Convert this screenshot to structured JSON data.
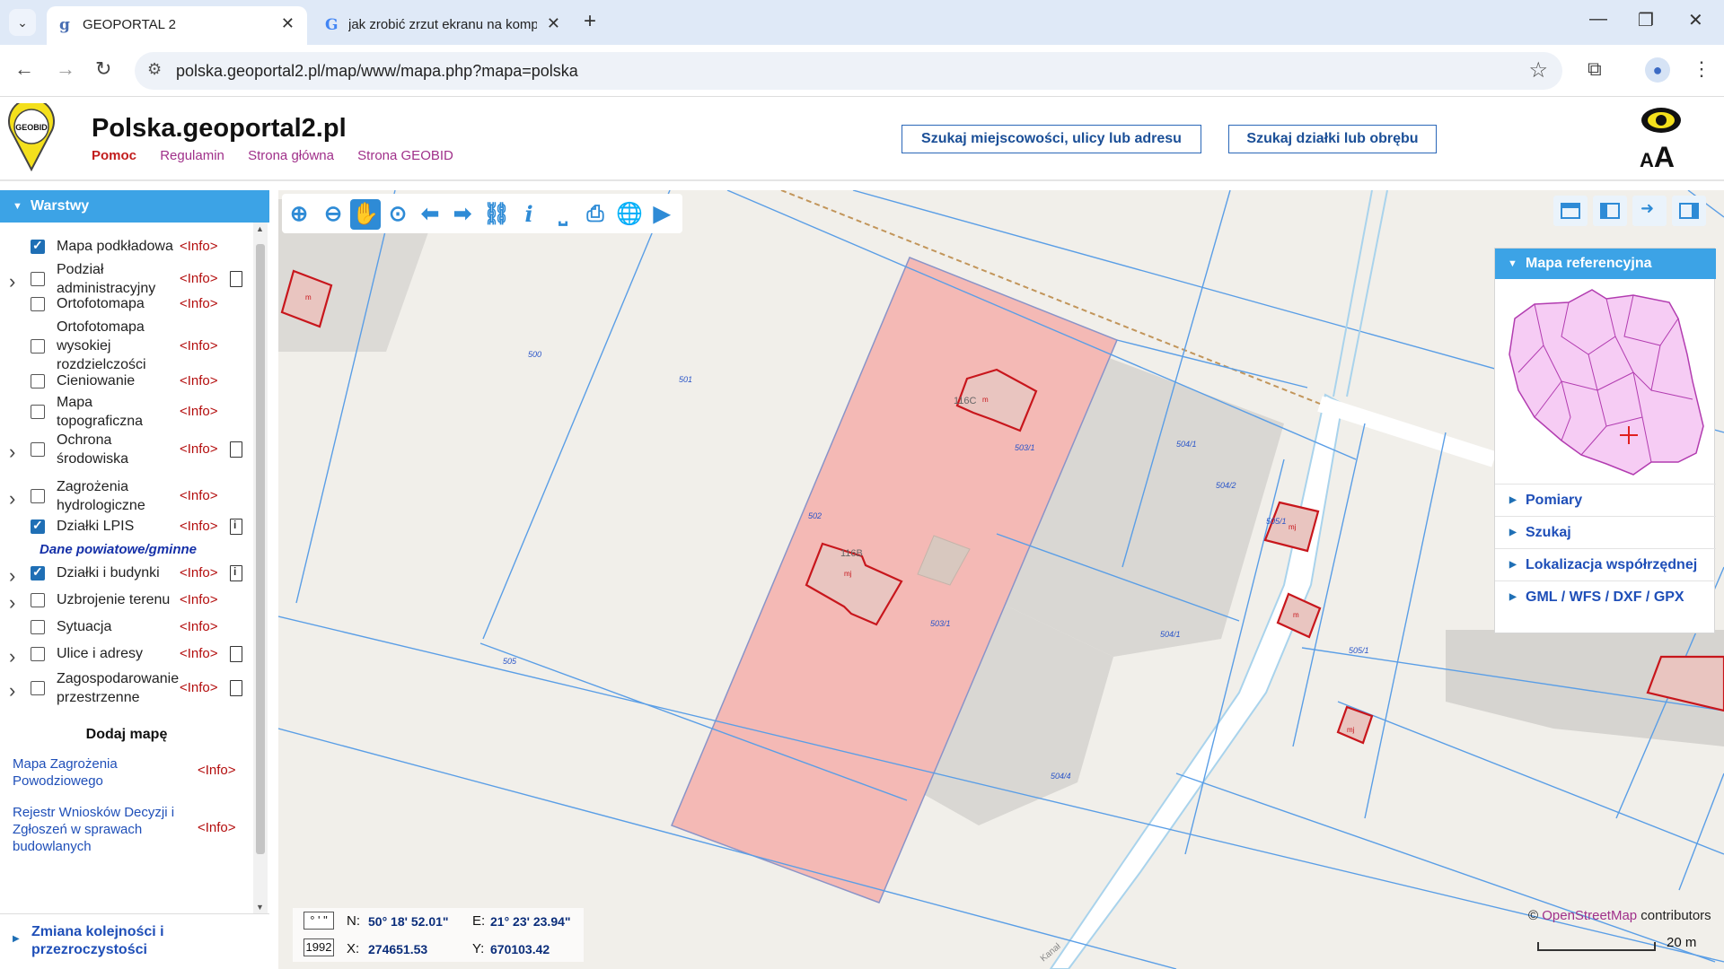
{
  "browser": {
    "tabs": [
      {
        "title": "GEOPORTAL 2",
        "active": true
      },
      {
        "title": "jak zrobić zrzut ekranu na komp",
        "active": false
      }
    ],
    "url": "polska.geoportal2.pl/map/www/mapa.php?mapa=polska"
  },
  "header": {
    "title": "Polska.geoportal2.pl",
    "links": [
      "Pomoc",
      "Regulamin",
      "Strona główna",
      "Strona GEOBID"
    ],
    "search_address_label": "Szukaj miejscowości, ulicy lub adresu",
    "search_parcel_label": "Szukaj działki lub obrębu",
    "accessibility_text": "AA",
    "logo_text": "GEOBID"
  },
  "layers_panel": {
    "title": "Warstwy",
    "layers": [
      {
        "name": "Mapa podkładowa",
        "checked": true,
        "expandable": false,
        "info": "<Info>",
        "doc_icon": "none"
      },
      {
        "name": "Podział administracyjny",
        "checked": false,
        "expandable": true,
        "info": "<Info>",
        "doc_icon": "document"
      },
      {
        "name": "Ortofotomapa",
        "checked": false,
        "expandable": false,
        "info": "<Info>",
        "doc_icon": "none"
      },
      {
        "name": "Ortofotomapa wysokiej rozdzielczości",
        "checked": false,
        "expandable": false,
        "info": "<Info>",
        "doc_icon": "none"
      },
      {
        "name": "Cieniowanie",
        "checked": false,
        "expandable": false,
        "info": "<Info>",
        "doc_icon": "none"
      },
      {
        "name": "Mapa topograficzna",
        "checked": false,
        "expandable": false,
        "info": "<Info>",
        "doc_icon": "none"
      },
      {
        "name": "Ochrona środowiska",
        "checked": false,
        "expandable": true,
        "info": "<Info>",
        "doc_icon": "document"
      },
      {
        "name": "Zagrożenia hydrologiczne",
        "checked": false,
        "expandable": true,
        "info": "<Info>",
        "doc_icon": "none"
      },
      {
        "name": "Działki LPIS",
        "checked": true,
        "expandable": false,
        "info": "<Info>",
        "doc_icon": "document-info"
      }
    ],
    "section_label": "Dane powiatowe/gminne",
    "local_layers": [
      {
        "name": "Działki i budynki",
        "checked": true,
        "expandable": true,
        "info": "<Info>",
        "doc_icon": "document-info"
      },
      {
        "name": "Uzbrojenie terenu",
        "checked": false,
        "expandable": true,
        "info": "<Info>",
        "doc_icon": "none"
      },
      {
        "name": "Sytuacja",
        "checked": false,
        "expandable": false,
        "info": "<Info>",
        "doc_icon": "none"
      },
      {
        "name": "Ulice i adresy",
        "checked": false,
        "expandable": true,
        "info": "<Info>",
        "doc_icon": "document"
      },
      {
        "name": "Zagospodarowanie przestrzenne",
        "checked": false,
        "expandable": true,
        "info": "<Info>",
        "doc_icon": "document"
      }
    ],
    "add_map_title": "Dodaj mapę",
    "external_maps": [
      {
        "name": "Mapa Zagrożenia Powodziowego",
        "info": "<Info>"
      },
      {
        "name": "Rejestr Wniosków Decyzji i Zgłoszeń w sprawach budowlanych",
        "info": "<Info>"
      }
    ],
    "footer": "Zmiana kolejności i przezroczystości"
  },
  "map": {
    "reference_panel": {
      "title": "Mapa referencyjna",
      "items": [
        "Pomiary",
        "Szukaj",
        "Lokalizacja współrzędnej",
        "GML / WFS / DXF / GPX"
      ]
    },
    "coordinates": {
      "format_box": "° ' \"",
      "system_box": "1992",
      "n_label": "N:",
      "n_value": "50° 18' 52.01\"",
      "e_label": "E:",
      "e_value": "21° 23' 23.94\"",
      "x_label": "X:",
      "x_value": "274651.53",
      "y_label": "Y:",
      "y_value": "670103.42"
    },
    "attribution_link": "OpenStreetMap",
    "attribution_suffix": " contributors",
    "attribution_prefix": "© ",
    "scale_label": "20 m",
    "parcel_labels": [
      "500",
      "501",
      "502",
      "503/1",
      "503/1",
      "504/1",
      "504/2",
      "505",
      "504/1",
      "505/1",
      "505/1",
      "504/4"
    ],
    "building_labels": [
      "116C",
      "116B",
      "mj",
      "mj",
      "mj",
      "m",
      "m",
      "m"
    ],
    "road_label": "Kanał"
  },
  "colors": {
    "accent_blue": "#3ca3e6",
    "highlight_parcel": "#f4b9b5",
    "building_outline": "#c8161c",
    "info_red": "#b30c0c"
  }
}
